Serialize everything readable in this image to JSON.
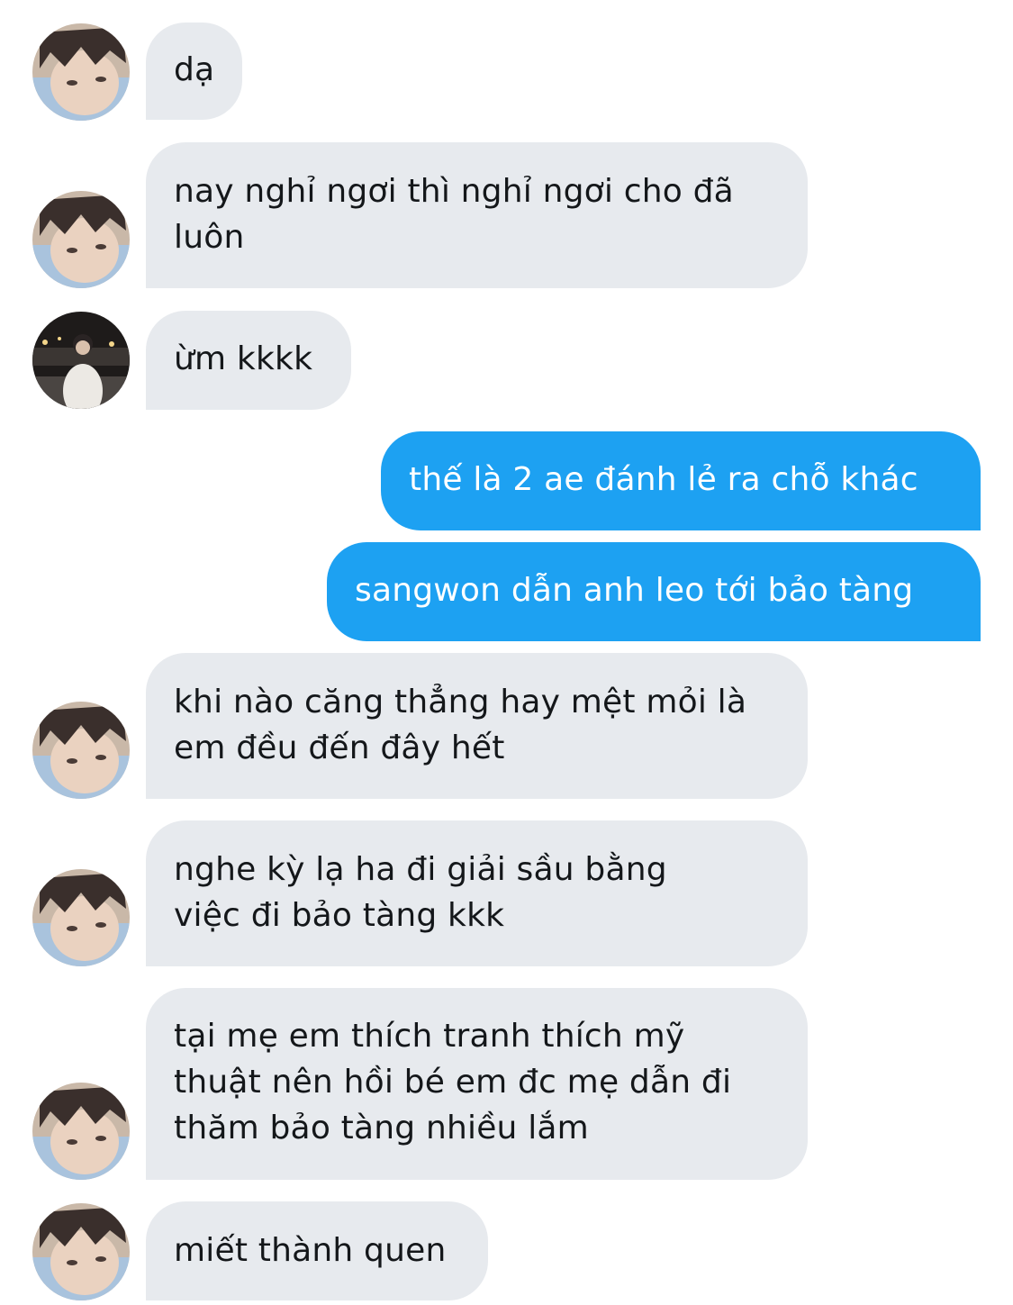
{
  "conversation": {
    "messages": [
      {
        "direction": "incoming",
        "avatar": "avatar-a",
        "lines": [
          "dạ"
        ]
      },
      {
        "direction": "incoming",
        "avatar": "avatar-a",
        "lines": [
          "nay nghỉ ngơi thì nghỉ ngơi cho đã",
          "luôn"
        ]
      },
      {
        "direction": "incoming",
        "avatar": "avatar-b",
        "lines": [
          "ừm kkkk"
        ]
      },
      {
        "direction": "outgoing",
        "lines": [
          "thế là 2 ae đánh lẻ ra chỗ khác"
        ]
      },
      {
        "direction": "outgoing",
        "lines": [
          "sangwon dẫn anh leo tới bảo tàng"
        ]
      },
      {
        "direction": "incoming",
        "avatar": "avatar-a",
        "lines": [
          "khi nào căng thẳng hay mệt mỏi là",
          "em đều đến đây hết"
        ]
      },
      {
        "direction": "incoming",
        "avatar": "avatar-a",
        "lines": [
          "nghe kỳ lạ ha đi giải sầu bằng",
          "việc đi bảo tàng kkk"
        ]
      },
      {
        "direction": "incoming",
        "avatar": "avatar-a",
        "lines": [
          "tại mẹ em thích tranh thích mỹ",
          "thuật nên hồi bé em đc mẹ dẫn đi",
          "thăm bảo tàng nhiều lắm"
        ]
      },
      {
        "direction": "incoming",
        "avatar": "avatar-a",
        "lines": [
          "miết thành quen"
        ]
      }
    ]
  },
  "colors": {
    "incoming_bubble": "#e7eaee",
    "incoming_text": "#14171a",
    "outgoing_bubble": "#1da1f2",
    "outgoing_text": "#ffffff",
    "background": "#ffffff"
  }
}
